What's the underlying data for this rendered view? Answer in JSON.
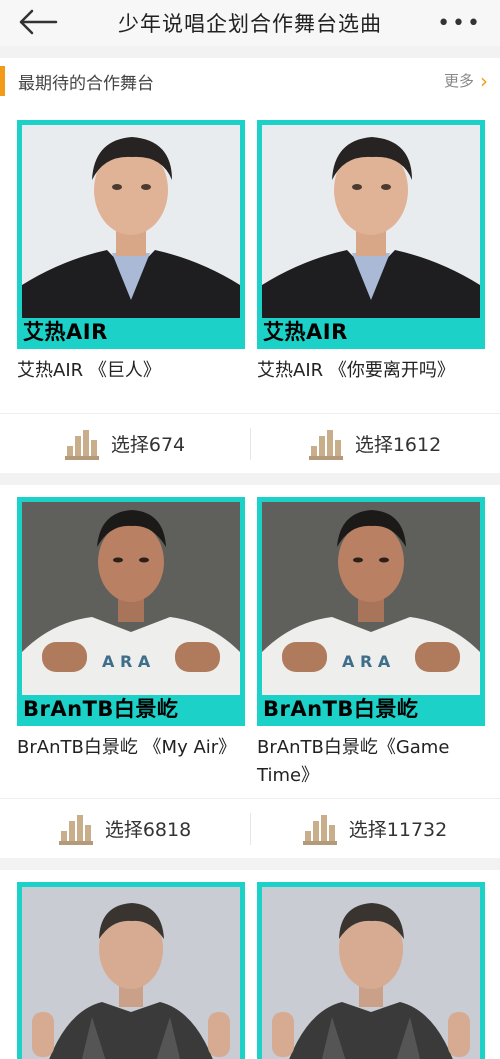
{
  "header": {
    "title": "少年说唱企划合作舞台选曲",
    "back_icon": "back-arrow-icon",
    "menu_icon": "more-dots-icon"
  },
  "section": {
    "title": "最期待的合作舞台",
    "more_label": "更多"
  },
  "pairs": [
    {
      "artist_theme": "air",
      "items": [
        {
          "tag": "艾热AIR",
          "caption": "艾热AIR 《巨人》",
          "votes": "选择674"
        },
        {
          "tag": "艾热AIR",
          "caption": "艾热AIR 《你要离开吗》",
          "votes": "选择1612"
        }
      ]
    },
    {
      "artist_theme": "brantb",
      "items": [
        {
          "tag": "BrAnTB白景屹",
          "caption": "BrAnTB白景屹 《My Air》",
          "votes": "选择6818"
        },
        {
          "tag": "BrAnTB白景屹",
          "caption": "BrAnTB白景屹《Game Time》",
          "votes": "选择11732"
        }
      ]
    },
    {
      "artist_theme": "third",
      "items": [
        {
          "tag": "",
          "caption": "",
          "votes": ""
        },
        {
          "tag": "",
          "caption": "",
          "votes": ""
        }
      ]
    }
  ],
  "colors": {
    "accent": "#f29b1b",
    "frame": "#1bd1c8"
  }
}
